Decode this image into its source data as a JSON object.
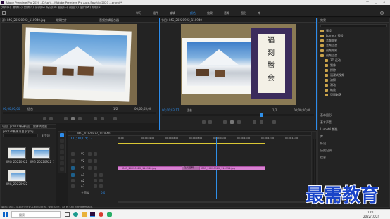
{
  "window": {
    "title": "Adobe Premiere Pro 2020 - D:\\\\pr\\\\...\\\\Adobe Premiere Pro Auto-Save\\\\pr2020 ...prproj *"
  },
  "menu": [
    "文件(F)",
    "编辑(E)",
    "剪辑(C)",
    "序列(S)",
    "标记(M)",
    "图形(G)",
    "视图(V)",
    "窗口(W)",
    "帮助(H)"
  ],
  "workspaces": [
    "学习",
    "组件",
    "编辑",
    "颜色",
    "效果",
    "音频",
    "图形",
    "库"
  ],
  "source": {
    "tab": "源: IMG_20220922_110940.jpg",
    "tab2": "效果控件",
    "tab3": "音频剪辑混合器",
    "timecode": "00;00;00;00",
    "fit": "适合",
    "fraction": "1/2",
    "duration": "00;00;05;00"
  },
  "program": {
    "tab": "节目: IMG_20220922_110940",
    "timecode": "00;00;03;17",
    "fit": "适合",
    "fraction": "1/2",
    "duration": "00;00;10;00",
    "sign_chars": [
      "福",
      "刻",
      "腾",
      "会"
    ]
  },
  "effects": {
    "title": "效果",
    "items": [
      "预设",
      "Lumetri 预设",
      "音频效果",
      "音频过渡",
      "视频效果",
      "视频过渡",
      "3D 运动",
      "划像",
      "擦除",
      "沉浸式视频",
      "溶解",
      "滑动",
      "缩放",
      "页面剥落"
    ],
    "more": [
      "基本图形",
      "基本声音",
      "Lumetri 颜色",
      "库",
      "标记",
      "历史记录",
      "信息"
    ]
  },
  "project": {
    "tab": "项目: pr2020新建项目",
    "tab2": "媒体浏览器",
    "file": "pr2020新建项目.prproj",
    "count": "3 个项",
    "clips": [
      "IMG_20220922_1109...",
      "IMG_20220922_1109...",
      "IMG_20220922"
    ]
  },
  "timeline": {
    "tab": "IMG_20220922_110940",
    "timecode": "00;00;03;17",
    "ruler": [
      "00;00",
      "00;00;02;00",
      "00;00;04;00",
      "00;00;06;00",
      "00;00;08;00",
      "00;00;10;00",
      "00;00;12;00",
      "00;00;14;00"
    ],
    "video_tracks": [
      "V3",
      "V2",
      "V1"
    ],
    "audio_tracks": [
      "A1",
      "A2",
      "A3"
    ],
    "master": "主声道",
    "master_val": "0.0",
    "clips": [
      "IMG_20220922_110940.jpg",
      "IMG_20220922_110954.jpg"
    ],
    "transition": "交叉溶解"
  },
  "status": "单击以选择，或单击空白处并拖动以框选。使用 Shift、Alt 和 Ctrl 可获得其他选项。",
  "taskbar": {
    "search": "搜索",
    "time": "13:17",
    "date": "2022/10/24"
  },
  "watermark": "最需教育",
  "colors": {
    "accent": "#2d8ceb",
    "clip": "#d87fd1",
    "playhead": "#2f8fe8",
    "folder": "#c8a24b"
  }
}
